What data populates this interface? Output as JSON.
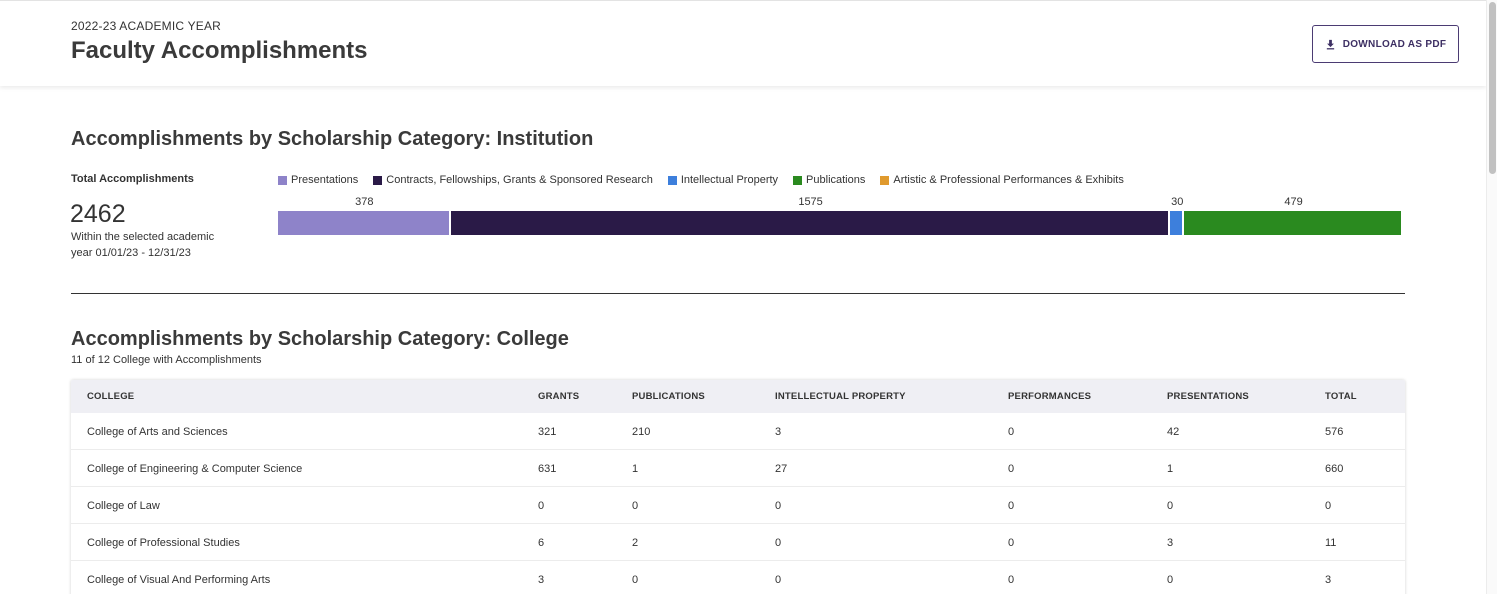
{
  "header": {
    "eyebrow": "2022-23 ACADEMIC YEAR",
    "title": "Faculty Accomplishments",
    "download_label": "DOWNLOAD AS PDF"
  },
  "institution": {
    "title": "Accomplishments by Scholarship Category: Institution",
    "total_label": "Total Accomplishments",
    "total_value": "2462",
    "total_sub": "Within the selected academic year 01/01/23 - 12/31/23"
  },
  "chart_data": {
    "type": "bar",
    "stacked": true,
    "orientation": "horizontal",
    "series": [
      {
        "name": "Presentations",
        "values": [
          378
        ],
        "color": "#8e83c9",
        "label": "378"
      },
      {
        "name": "Contracts, Fellowships, Grants & Sponsored Research",
        "values": [
          1575
        ],
        "color": "#2a1a47",
        "label": "1575"
      },
      {
        "name": "Intellectual Property",
        "values": [
          30
        ],
        "color": "#3d7fdc",
        "label": "30"
      },
      {
        "name": "Publications",
        "values": [
          479
        ],
        "color": "#2a8a1f",
        "label": "479"
      },
      {
        "name": "Artistic & Professional Performances & Exhibits",
        "values": [
          0
        ],
        "color": "#e09a2e",
        "label": ""
      }
    ],
    "legend_position": "top-left"
  },
  "college": {
    "title": "Accomplishments by Scholarship Category: College",
    "subtitle": "11 of 12 College with Accomplishments",
    "columns": [
      "COLLEGE",
      "GRANTS",
      "PUBLICATIONS",
      "INTELLECTUAL PROPERTY",
      "PERFORMANCES",
      "PRESENTATIONS",
      "TOTAL"
    ],
    "rows": [
      [
        "College of Arts and Sciences",
        "321",
        "210",
        "3",
        "0",
        "42",
        "576"
      ],
      [
        "College of Engineering & Computer Science",
        "631",
        "1",
        "27",
        "0",
        "1",
        "660"
      ],
      [
        "College of Law",
        "0",
        "0",
        "0",
        "0",
        "0",
        "0"
      ],
      [
        "College of Professional Studies",
        "6",
        "2",
        "0",
        "0",
        "3",
        "11"
      ],
      [
        "College of Visual And Performing Arts",
        "3",
        "0",
        "0",
        "0",
        "0",
        "3"
      ]
    ]
  },
  "icons": {
    "download": "download-icon"
  }
}
